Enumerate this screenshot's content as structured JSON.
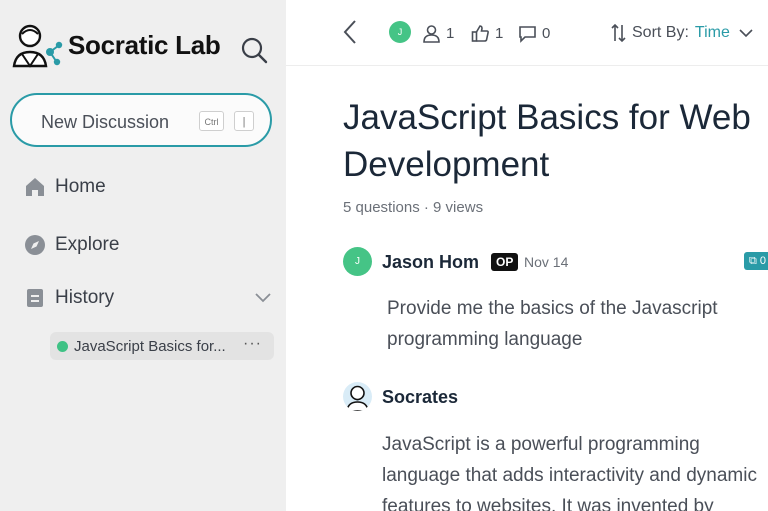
{
  "app": {
    "name": "Socratic Lab",
    "accent": "#2a9ba7",
    "green": "#45c486"
  },
  "sidebar": {
    "new_discussion": {
      "label": "New Discussion",
      "shortcut_mod": "Ctrl",
      "shortcut_key": "|"
    },
    "nav": [
      {
        "label": "Home",
        "icon": "home-icon"
      },
      {
        "label": "Explore",
        "icon": "compass-icon"
      },
      {
        "label": "History",
        "icon": "document-icon"
      }
    ],
    "history": [
      {
        "label": "JavaScript Basics for...",
        "more": "···"
      }
    ]
  },
  "topbar": {
    "avatar_initial": "J",
    "participants": "1",
    "likes": "1",
    "comments": "0",
    "sort_label": "Sort By:",
    "sort_value": "Time"
  },
  "discussion": {
    "title": "JavaScript Basics for Web Development",
    "meta": "5 questions · 9 views",
    "messages": [
      {
        "author": "Jason Hom",
        "avatar_initial": "J",
        "badge": "OP",
        "date": "Nov 14",
        "edge_badge": "0",
        "text": "Provide me the basics of the Javascript programming language"
      },
      {
        "author": "Socrates",
        "text": "JavaScript is a powerful programming language that adds interactivity and dynamic features to websites. It was invented by"
      }
    ]
  }
}
